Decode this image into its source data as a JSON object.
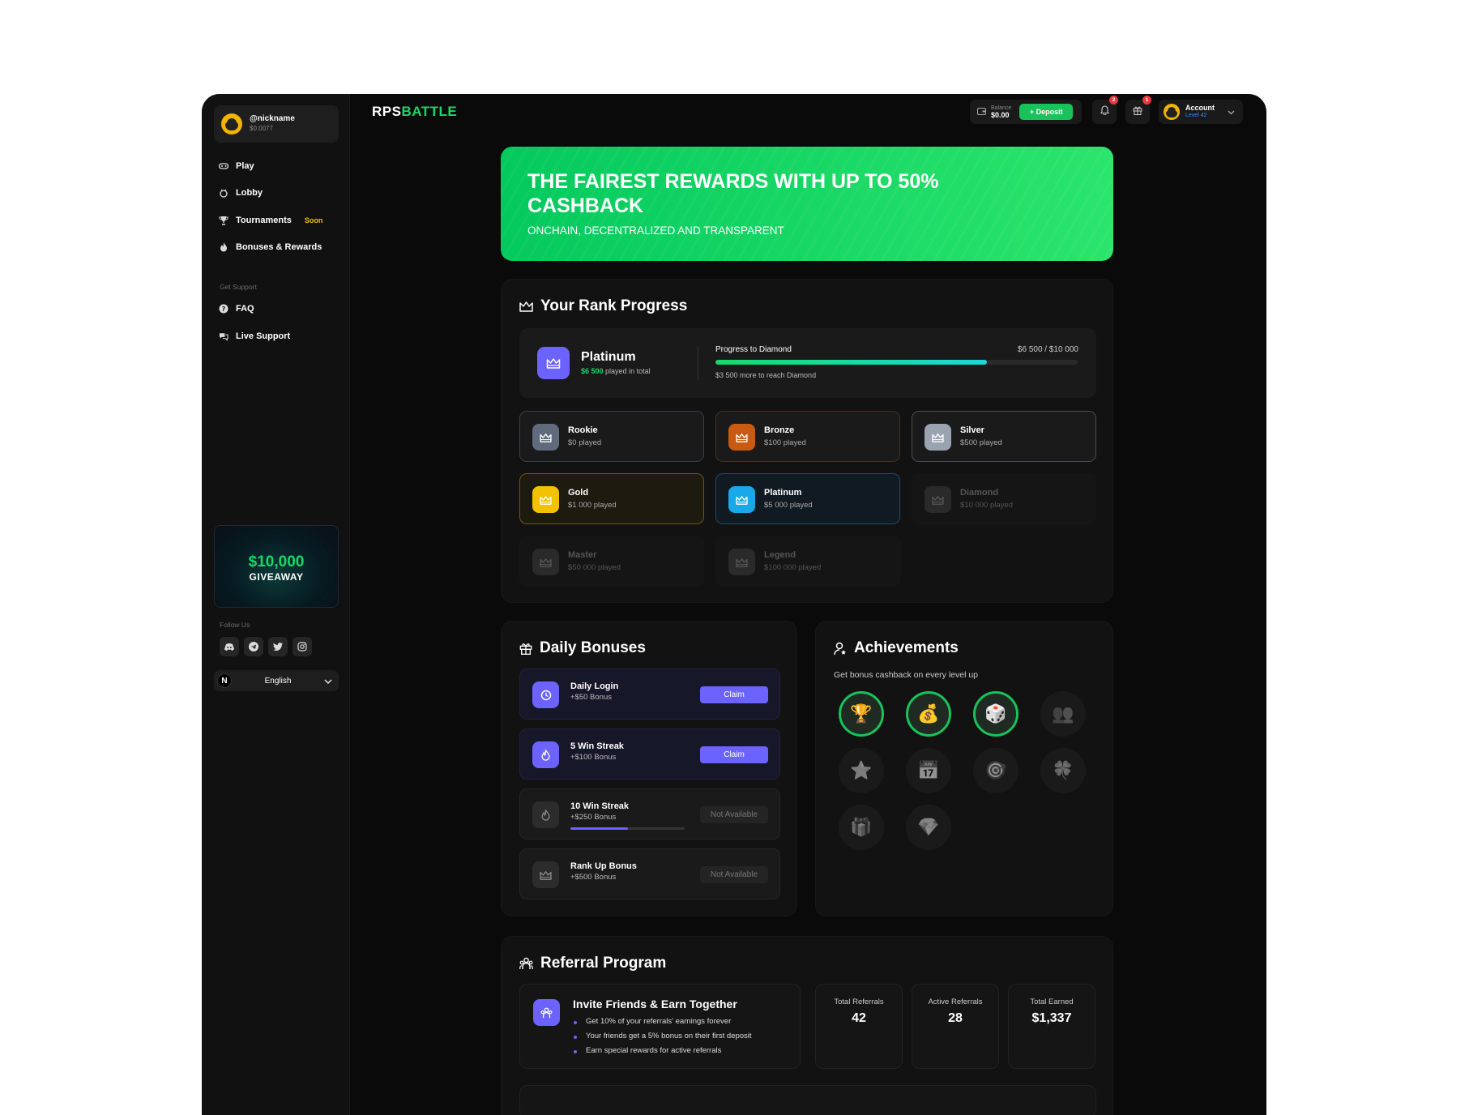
{
  "profile": {
    "nickname": "@nickname",
    "balance": "$0.0077"
  },
  "nav": {
    "play": "Play",
    "lobby": "Lobby",
    "tournaments": "Tournaments",
    "tournaments_badge": "Soon",
    "bonuses": "Bonuses & Rewards",
    "support_section": "Get Support",
    "faq": "FAQ",
    "live_support": "Live Support"
  },
  "giveaway": {
    "amount": "$10,000",
    "label": "GIVEAWAY"
  },
  "follow": {
    "label": "Follow Us",
    "icons": [
      "discord-icon",
      "telegram-icon",
      "twitter-icon",
      "instagram-icon"
    ]
  },
  "language": {
    "selected": "English"
  },
  "logo": {
    "part1": "RPS",
    "part2": "BATTLE"
  },
  "topbar": {
    "balance_label": "Balance",
    "balance_value": "$0.00",
    "deposit_label": "+ Deposit",
    "notif_count": "2",
    "gift_count": "1",
    "account_label": "Account",
    "account_level": "Level 42"
  },
  "hero": {
    "title": "THE FAIREST REWARDS WITH UP TO 50% CASHBACK",
    "subtitle": "ONCHAIN, DECENTRALIZED AND TRANSPARENT"
  },
  "rank": {
    "title": "Your Rank Progress",
    "current": "Platinum",
    "played_amount": "$6 500",
    "played_suffix": "played in total",
    "progress_label": "Progress to Diamond",
    "progress_value": "$6 500 / $10 000",
    "progress_fraction": 0.75,
    "progress_note": "$3 500 more to reach Diamond",
    "tiers": [
      {
        "name": "Rookie",
        "sub": "$0 played",
        "color": "#5f6b7c",
        "border": "#3a3f46",
        "locked": false
      },
      {
        "name": "Bronze",
        "sub": "$100 played",
        "color": "#c95a12",
        "border": "#4a2f20",
        "locked": false
      },
      {
        "name": "Silver",
        "sub": "$500 played",
        "color": "#9aa3b0",
        "border": "#4a4d52",
        "locked": false
      },
      {
        "name": "Gold",
        "sub": "$1 000 played",
        "color": "#f2c200",
        "border": "#6b5a14",
        "locked": false
      },
      {
        "name": "Platinum",
        "sub": "$5 000 played",
        "color": "#1aa9e8",
        "border": "#1e4a66",
        "locked": false
      },
      {
        "name": "Diamond",
        "sub": "$10 000 played",
        "color": "#2a2a2a",
        "border": "#161616",
        "locked": true
      },
      {
        "name": "Master",
        "sub": "$50 000 played",
        "color": "#2a2a2a",
        "border": "#161616",
        "locked": true
      },
      {
        "name": "Legend",
        "sub": "$100 000 played",
        "color": "#2a2a2a",
        "border": "#161616",
        "locked": true
      }
    ]
  },
  "daily": {
    "title": "Daily Bonuses",
    "items": [
      {
        "name": "Daily Login",
        "sub": "+$50 Bonus",
        "button": "Claim",
        "available": true
      },
      {
        "name": "5 Win Streak",
        "sub": "+$100 Bonus",
        "button": "Claim",
        "available": true
      },
      {
        "name": "10 Win Streak",
        "sub": "+$250 Bonus",
        "button": "Not Available",
        "available": false,
        "progress": 0.5
      },
      {
        "name": "Rank Up Bonus",
        "sub": "+$500 Bonus",
        "button": "Not Available",
        "available": false
      }
    ]
  },
  "achievements": {
    "title": "Achievements",
    "subtitle": "Get bonus cashback on every level up",
    "items": [
      {
        "glyph": "🏆",
        "icon": "trophy-icon",
        "unlocked": true
      },
      {
        "glyph": "💰",
        "icon": "money-bag-icon",
        "unlocked": true
      },
      {
        "glyph": "🎲",
        "icon": "dice-icon",
        "unlocked": true
      },
      {
        "glyph": "👥",
        "icon": "users-icon",
        "unlocked": false
      },
      {
        "glyph": "⭐",
        "icon": "star-icon",
        "unlocked": false
      },
      {
        "glyph": "📅",
        "icon": "calendar-icon",
        "unlocked": false
      },
      {
        "glyph": "🎯",
        "icon": "target-icon",
        "unlocked": false
      },
      {
        "glyph": "🍀",
        "icon": "clover-icon",
        "unlocked": false
      },
      {
        "glyph": "🎁",
        "icon": "gift-icon",
        "unlocked": false
      },
      {
        "glyph": "💎",
        "icon": "diamond-icon",
        "unlocked": false
      }
    ]
  },
  "referral": {
    "title": "Referral Program",
    "invite_title": "Invite Friends & Earn Together",
    "bullets": [
      "Get 10% of your referrals' earnings forever",
      "Your friends get a 5% bonus on their first deposit",
      "Earn special rewards for active referrals"
    ],
    "stats": [
      {
        "label": "Total Referrals",
        "value": "42"
      },
      {
        "label": "Active Referrals",
        "value": "28"
      },
      {
        "label": "Total Earned",
        "value": "$1,337"
      }
    ]
  }
}
